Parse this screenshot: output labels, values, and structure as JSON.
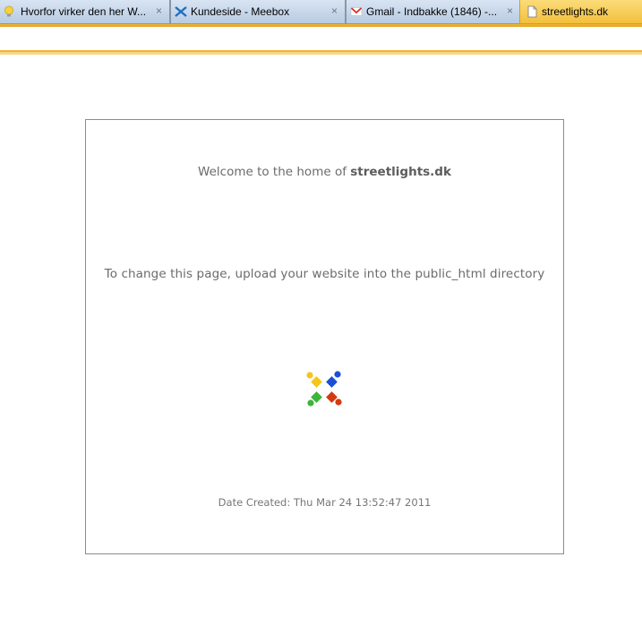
{
  "tabs": [
    {
      "label": "Hvorfor virker den her W...",
      "icon": "lightbulb-icon",
      "close": "×"
    },
    {
      "label": "Kundeside - Meebox",
      "icon": "meebox-x-icon",
      "close": "×"
    },
    {
      "label": "Gmail - Indbakke (1846) -...",
      "icon": "gmail-icon",
      "close": "×"
    },
    {
      "label": "streetlights.dk",
      "icon": "page-icon",
      "active": true
    }
  ],
  "page": {
    "welcome_prefix": "Welcome to the home of ",
    "welcome_domain": "streetlights.dk",
    "instruction": "To change this page, upload your website into the public_html directory",
    "date_created": "Date Created: Thu Mar 24 13:52:47 2011"
  },
  "colors": {
    "tab_bar": "#f1b62b",
    "logo_yellow": "#f5c518",
    "logo_blue": "#1a4fd6",
    "logo_green": "#3cb43c",
    "logo_red": "#d23a10"
  }
}
